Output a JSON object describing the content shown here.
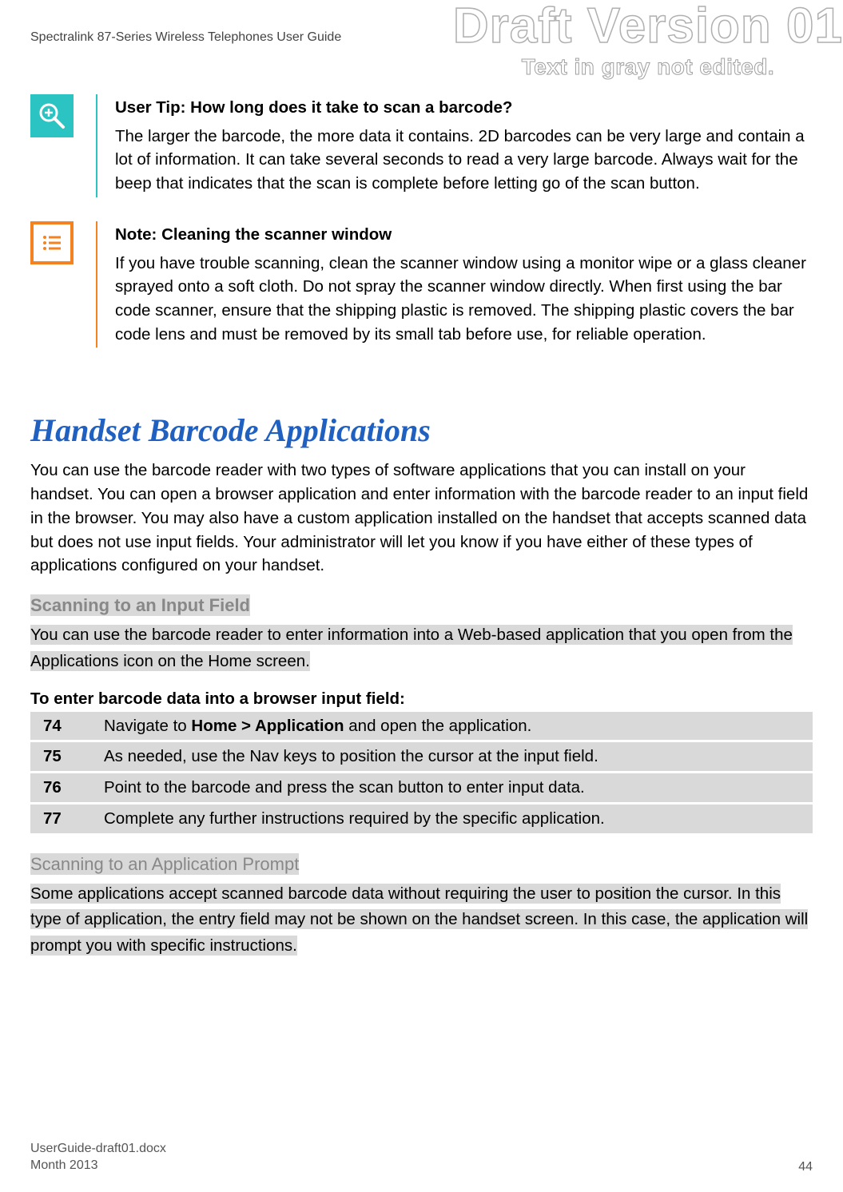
{
  "header": {
    "title": "Spectralink 87-Series Wireless Telephones User Guide"
  },
  "watermark": {
    "main": "Draft Version 01",
    "sub": "Text in gray not edited."
  },
  "tip": {
    "title": "User Tip: How long does it take to scan a barcode?",
    "body": "The larger the barcode, the more data it contains. 2D barcodes can be very large and contain a lot of information. It can take several seconds to read a very large barcode. Always wait for the beep that indicates that the scan is complete before letting go of the scan button."
  },
  "note": {
    "title": "Note: Cleaning the scanner window",
    "body": "If you have trouble scanning, clean the scanner window using a monitor wipe or a glass cleaner sprayed onto a soft cloth. Do not spray the scanner window directly. When first using the bar code scanner, ensure that the shipping plastic is removed. The shipping plastic covers the bar code lens and must be removed by its small tab before use, for reliable operation."
  },
  "section": {
    "heading": "Handset Barcode Applications",
    "intro": "You can use the barcode reader with two types of software applications that you can install on your handset. You can open a browser application and enter information with the barcode reader to an input field in the browser. You may also have a custom application installed on the handset that accepts scanned data but does not use input fields. Your administrator will let you know if you have either of these types of applications configured on your handset."
  },
  "sub1": {
    "heading": "Scanning to an Input Field",
    "text": "You can use the barcode reader to enter information into a Web-based application that you open from the Applications icon on the Home screen.",
    "stepsTitle": "To enter barcode data into a browser input field:",
    "steps": [
      {
        "num": "74",
        "pre": "Navigate to ",
        "bold": "Home > Application",
        "post": " and open the application."
      },
      {
        "num": "75",
        "pre": "As needed, use the Nav keys to position the cursor at the input field.",
        "bold": "",
        "post": ""
      },
      {
        "num": "76",
        "pre": "Point to the barcode and press the scan button to enter input data.",
        "bold": "",
        "post": ""
      },
      {
        "num": "77",
        "pre": "Complete any further instructions required by the specific application.",
        "bold": "",
        "post": ""
      }
    ]
  },
  "sub2": {
    "heading": "Scanning to an Application Prompt",
    "text": "Some applications accept scanned barcode data without requiring the user to position the cursor. In this type of application, the entry field may not be shown on the handset screen. In this case, the application will prompt you with specific instructions."
  },
  "footer": {
    "filename": "UserGuide-draft01.docx",
    "date": "Month 2013",
    "page": "44"
  }
}
